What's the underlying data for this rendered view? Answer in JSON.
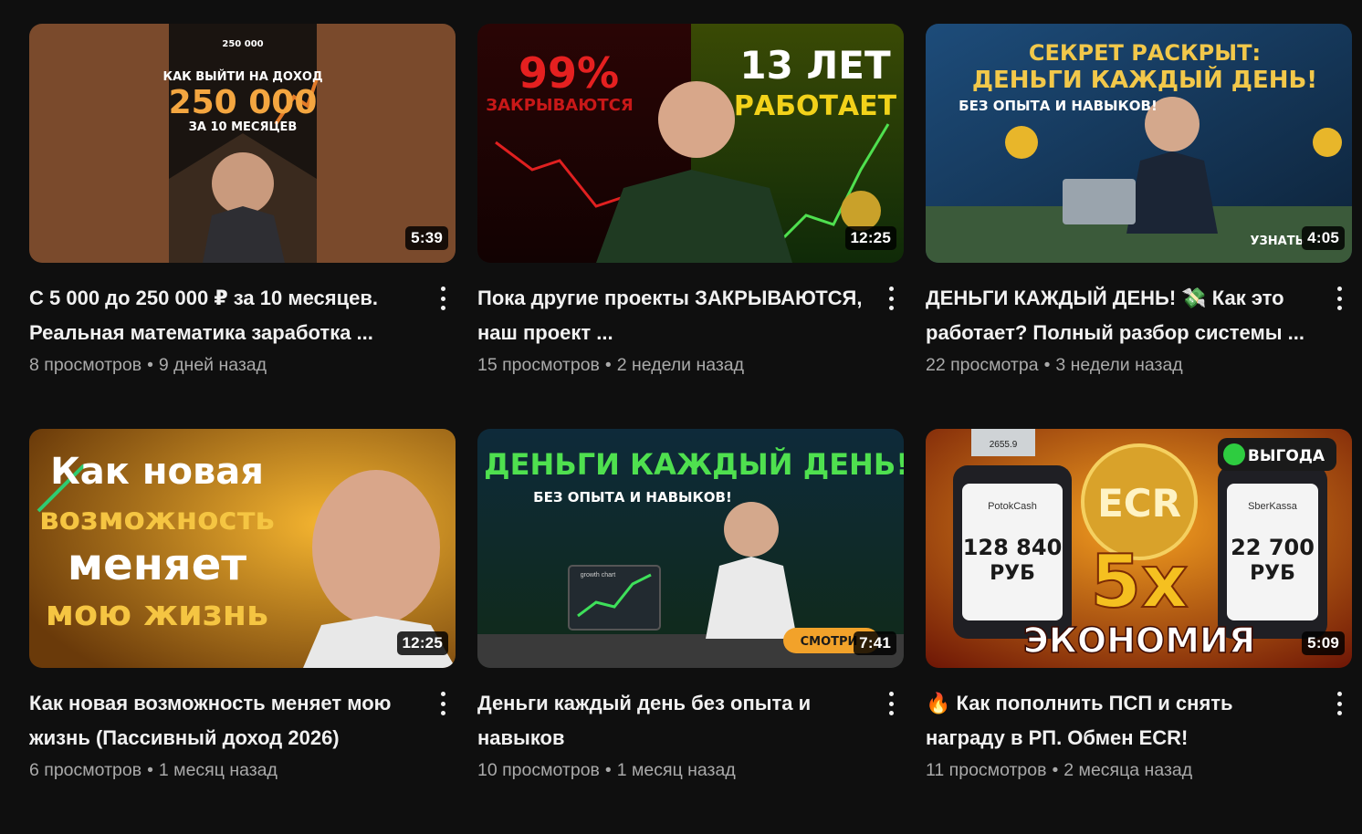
{
  "videos": [
    {
      "title": "С 5 000 до 250 000 ₽ за 10 месяцев. Реальная математика заработка ...",
      "views": "8 просмотров",
      "age": "9 дней назад",
      "duration": "5:39",
      "thumb_text": [
        "250 000",
        "КАК ВЫЙТИ НА ДОХОД",
        "250 000",
        "ЗА 10 МЕСЯЦЕВ"
      ]
    },
    {
      "title": "Пока другие проекты ЗАКРЫВАЮТСЯ, наш проект ...",
      "views": "15 просмотров",
      "age": "2 недели назад",
      "duration": "12:25",
      "thumb_text": [
        "99%",
        "ЗАКРЫВАЮТСЯ",
        "13 ЛЕТ",
        "РАБОТАЕТ"
      ]
    },
    {
      "title": "ДЕНЬГИ КАЖДЫЙ ДЕНЬ! 💸 Как это работает? Полный разбор системы ...",
      "views": "22 просмотра",
      "age": "3 недели назад",
      "duration": "4:05",
      "thumb_text": [
        "СЕКРЕТ РАСКРЫТ:",
        "ДЕНЬГИ КАЖДЫЙ ДЕНЬ!",
        "БЕЗ ОПЫТА И НАВЫКОВ!",
        "УЗНАТЬ"
      ]
    },
    {
      "title": "Как новая возможность меняет мою жизнь (Пассивный доход 2026)",
      "views": "6 просмотров",
      "age": "1 месяц назад",
      "duration": "12:25",
      "thumb_text": [
        "Как новая",
        "возможность",
        "меняет",
        "мою жизнь"
      ]
    },
    {
      "title": "Деньги каждый день без опыта и навыков",
      "views": "10 просмотров",
      "age": "1 месяц назад",
      "duration": "7:41",
      "thumb_text": [
        "ДЕНЬГИ КАЖДЫЙ ДЕНЬ!",
        "БЕЗ ОПЫТА И НАВЫКОВ!",
        "СМОТРИ",
        "growth chart"
      ]
    },
    {
      "title": "🔥 Как пополнить ПСП и снять награду в РП. Обмен ECR!",
      "views": "11 просмотров",
      "age": "2 месяца назад",
      "duration": "5:09",
      "thumb_text": [
        "ВЫГОДА",
        "ECR",
        "128 840",
        "РУБ",
        "22 700",
        "РУБ",
        "5x",
        "ЭКОНОМИЯ",
        "PotokCash",
        "SberKassa",
        "2655.9"
      ]
    }
  ],
  "separator": "•",
  "colors": {
    "background": "#0f0f0f",
    "title": "#f1f1f1",
    "meta": "#aaaaaa"
  }
}
